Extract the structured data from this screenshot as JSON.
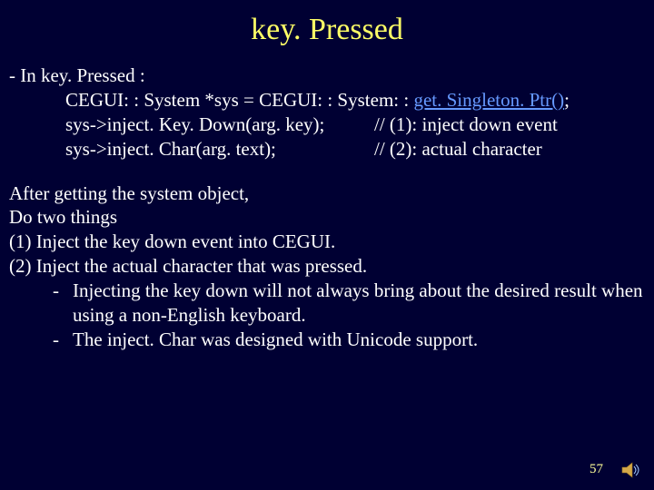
{
  "title": "key. Pressed",
  "intro": "- In key. Pressed :",
  "code": {
    "l1a": "CEGUI: : System *sys = CEGUI: : System: : ",
    "l1b": "get. Singleton. Ptr()",
    "l1c": ";",
    "l2a": "sys->inject. Key. Down(arg. key);",
    "l2b": "// (1): inject down event",
    "l3a": "sys->inject. Char(arg. text);",
    "l3b": "// (2): actual character"
  },
  "after1": "After getting the system object,",
  "after2": "Do two things",
  "after3": "(1) Inject the key down event into CEGUI.",
  "after4": "(2) Inject the actual character that was pressed.",
  "sub1": "Injecting the key down will not always bring about the desired result when using a non-English keyboard.",
  "sub2": "The inject. Char was designed with Unicode support.",
  "dash": "-",
  "pagenum": "57"
}
